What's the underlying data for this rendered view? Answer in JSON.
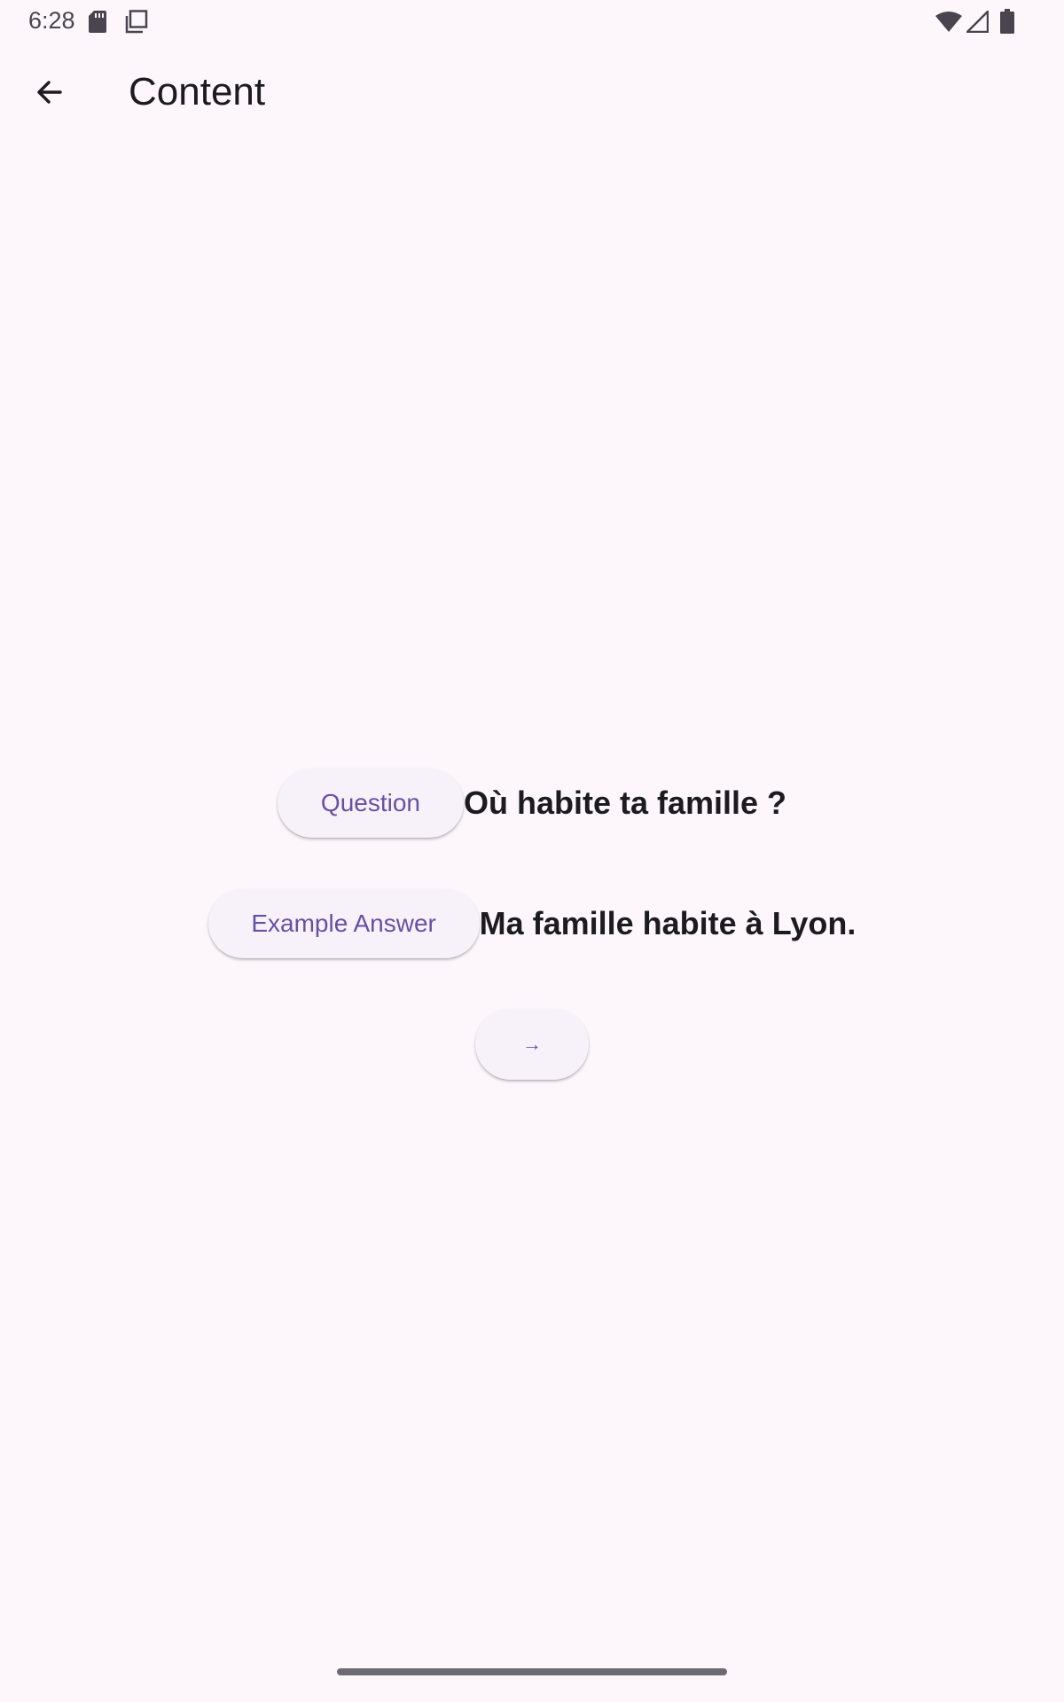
{
  "status_bar": {
    "time": "6:28",
    "icons": [
      "sd-card-icon",
      "copy-icon",
      "wifi-icon",
      "signal-icon",
      "battery-icon"
    ]
  },
  "app_bar": {
    "back_icon": "arrow-back-icon",
    "title": "Content"
  },
  "content": {
    "question_label": "Question",
    "question_text": "Où habite ta famille ?",
    "answer_label": "Example Answer",
    "answer_text": "Ma famille habite à Lyon.",
    "next_label": "→"
  },
  "colors": {
    "background": "#fdf7fc",
    "accent": "#6750a4",
    "button_surface": "#f7f2fa",
    "text": "#1c1b1f"
  }
}
